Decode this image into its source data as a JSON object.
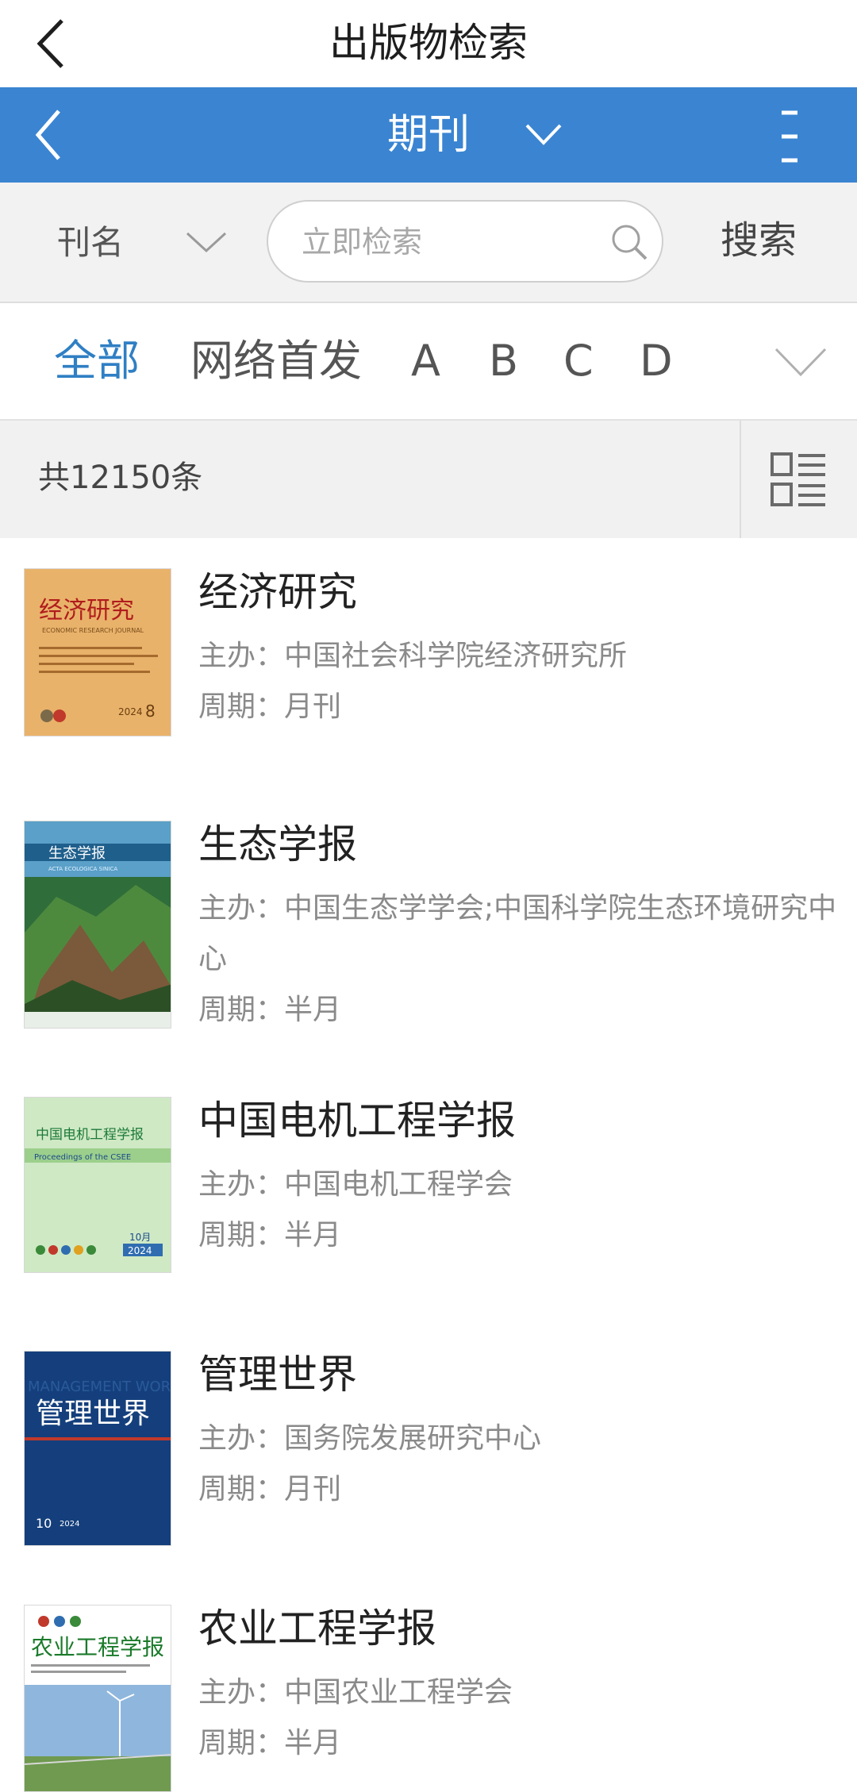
{
  "header": {
    "title": "出版物检索"
  },
  "nav": {
    "category": "期刊"
  },
  "search": {
    "field": "刊名",
    "placeholder": "立即检索",
    "button": "搜索"
  },
  "tabs": [
    "全部",
    "网络首发",
    "A",
    "B",
    "C",
    "D"
  ],
  "active_tab": "全部",
  "count_text": "共12150条",
  "meta_labels": {
    "sponsor": "主办：",
    "period": "周期："
  },
  "journals": [
    {
      "name": "经济研究",
      "sponsor": "中国社会科学院经济研究所",
      "period": "月刊",
      "cover": {
        "title": "经济研究",
        "subtitle": "ECONOMIC RESEARCH JOURNAL",
        "year": "2024",
        "issue": "8",
        "bg": "#e9b26a"
      }
    },
    {
      "name": "生态学报",
      "sponsor": "中国生态学学会;中国科学院生态环境研究中",
      "sponsor_cont": "心",
      "period": "半月",
      "cover": {
        "title": "生态学报",
        "subtitle": "ACTA ECOLOGICA SINICA",
        "bg": "#2f6d3a"
      }
    },
    {
      "name": "中国电机工程学报",
      "sponsor": "中国电机工程学会",
      "period": "半月",
      "cover": {
        "title": "中国电机工程学报",
        "subtitle": "Proceedings of the CSEE",
        "month": "10月",
        "year": "2024",
        "bg": "#cfe9c5"
      }
    },
    {
      "name": "管理世界",
      "sponsor": "国务院发展研究中心",
      "period": "月刊",
      "cover": {
        "title": "管理世界",
        "watermark": "MANAGEMENT WORLD",
        "issue": "10",
        "year": "2024",
        "bg": "#143f7c"
      }
    },
    {
      "name": "农业工程学报",
      "sponsor": "中国农业工程学会",
      "period": "半月",
      "cover": {
        "title": "农业工程学报",
        "bg": "#ffffff"
      }
    }
  ]
}
